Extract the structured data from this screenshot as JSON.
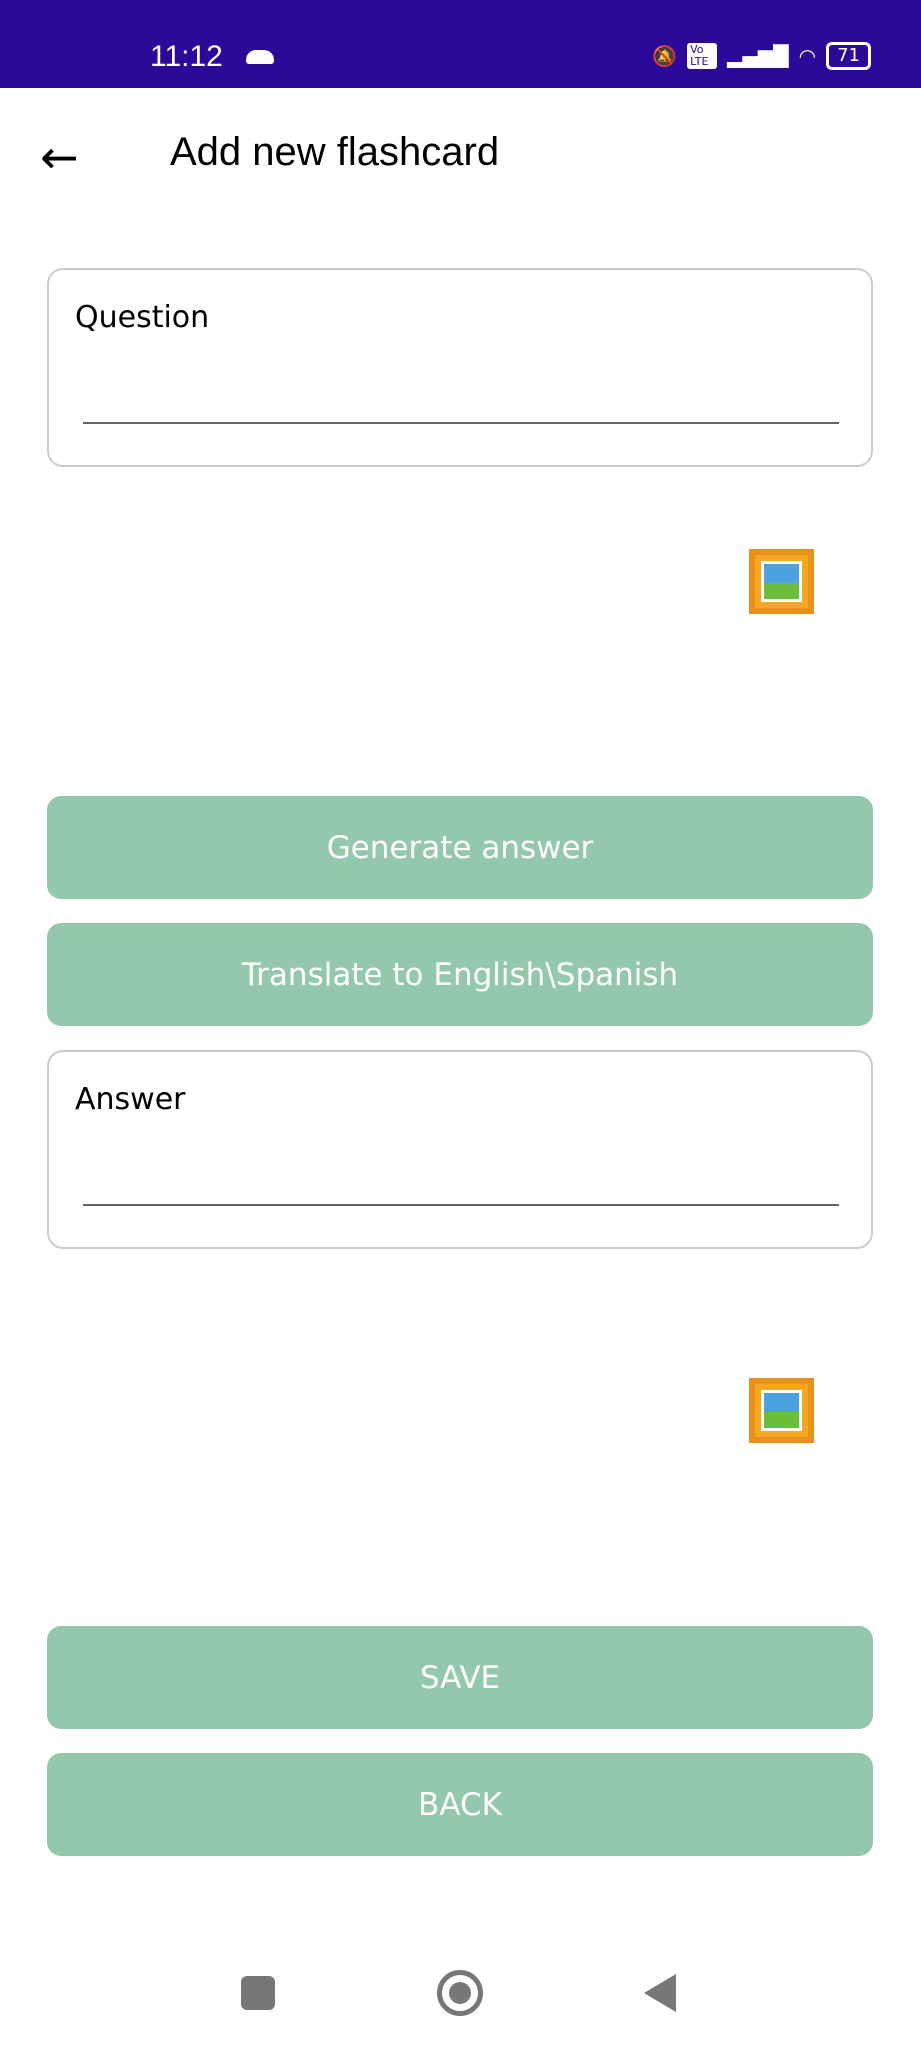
{
  "status_bar": {
    "time": "11:12",
    "battery": "71",
    "network": "Vo LTE"
  },
  "header": {
    "title": "Add new flashcard"
  },
  "question": {
    "label": "Question",
    "value": ""
  },
  "answer": {
    "label": "Answer",
    "value": ""
  },
  "buttons": {
    "generate": "Generate answer",
    "translate": "Translate to English\\Spanish",
    "save": "SAVE",
    "back": "BACK"
  },
  "colors": {
    "status_bar": "#2c0a99",
    "button": "#93c9aa"
  }
}
